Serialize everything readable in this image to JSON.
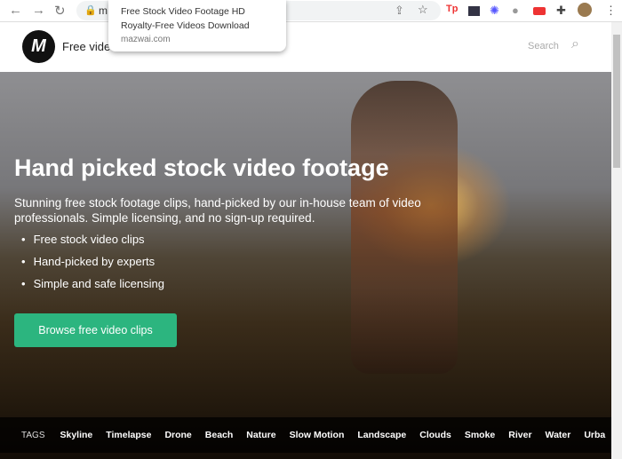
{
  "browser": {
    "url_partial": "m",
    "tooltip": {
      "title_line1": "Free Stock Video Footage HD",
      "title_line2": "Royalty-Free Videos Download",
      "domain": "mazwai.com"
    }
  },
  "header": {
    "logo": "M",
    "brand": "Free vide",
    "search_placeholder": "Search"
  },
  "hero": {
    "title": "Hand picked stock video footage",
    "subtitle": "Stunning free stock footage clips, hand-picked by our in-house team of video professionals. Simple licensing, and no sign-up required.",
    "bullets": [
      "Free stock video clips",
      "Hand-picked by experts",
      "Simple and safe licensing"
    ],
    "cta": "Browse free video clips"
  },
  "tags": {
    "label": "TAGS",
    "items": [
      "Skyline",
      "Timelapse",
      "Drone",
      "Beach",
      "Nature",
      "Slow Motion",
      "Landscape",
      "Clouds",
      "Smoke",
      "River",
      "Water",
      "Urba"
    ]
  },
  "colors": {
    "accent": "#2cb57f"
  }
}
